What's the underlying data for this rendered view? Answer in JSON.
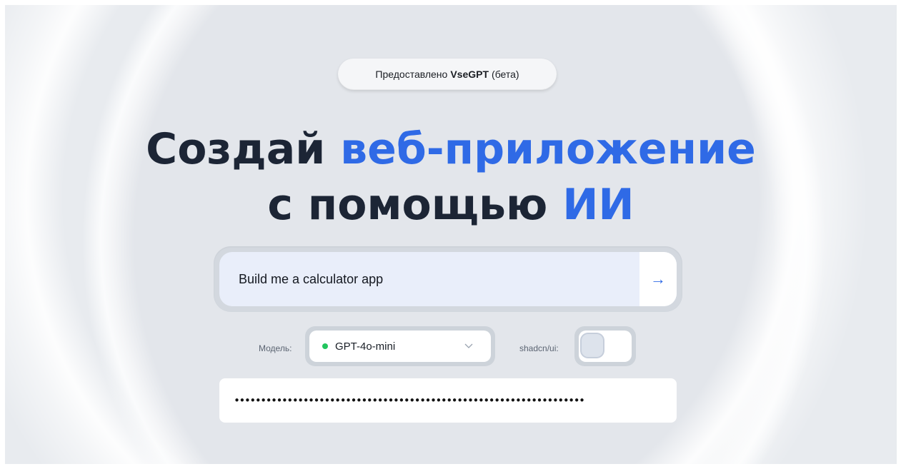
{
  "attribution": {
    "prefix": "Предоставлено",
    "brand": "VseGPT",
    "suffix": "(бета)"
  },
  "headline": {
    "line1_plain": "Создай",
    "line1_accent": "веб-приложение",
    "line2_plain": "с помощью",
    "line2_accent": "ИИ",
    "accent_color": "#2f6ae6"
  },
  "prompt": {
    "value": "Build me a calculator app",
    "submit_icon": "arrow-right-icon",
    "submit_glyph": "→"
  },
  "model": {
    "label": "Модель:",
    "selected": "GPT-4o-mini",
    "status_color": "#22c55e",
    "dropdown_icon": "chevron-down-icon"
  },
  "shadcn": {
    "label": "shadcn/ui:",
    "enabled": false
  },
  "api_key": {
    "value": "••••••••••••••••••••••••••••••••••••••••••••••••••••••••••••••••••"
  }
}
